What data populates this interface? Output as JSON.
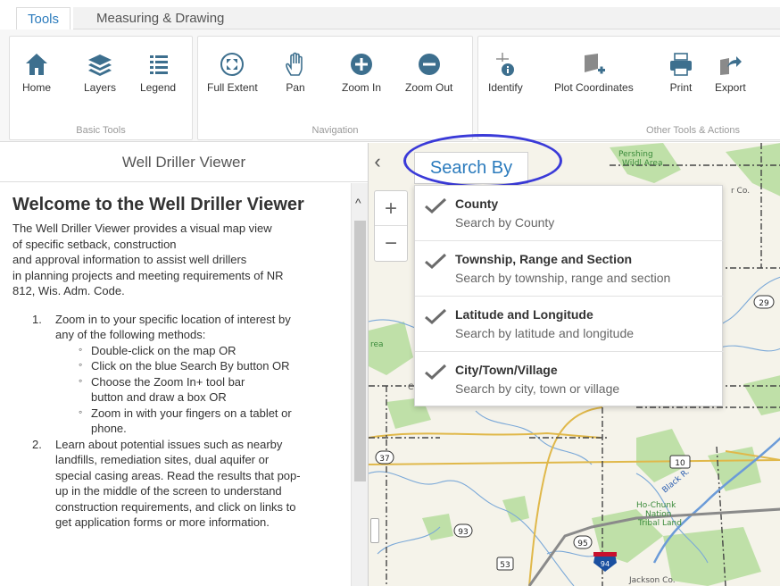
{
  "tabs": [
    {
      "label": "Tools",
      "active": true
    },
    {
      "label": "Measuring & Drawing",
      "active": false
    }
  ],
  "ribbon": {
    "groups": [
      {
        "caption": "Basic Tools",
        "tools": [
          {
            "label": "Home",
            "icon": "home-icon"
          },
          {
            "label": "Layers",
            "icon": "layers-icon"
          },
          {
            "label": "Legend",
            "icon": "legend-icon"
          }
        ]
      },
      {
        "caption": "Navigation",
        "tools": [
          {
            "label": "Full Extent",
            "icon": "full-extent-icon"
          },
          {
            "label": "Pan",
            "icon": "pan-hand-icon"
          },
          {
            "label": "Zoom In",
            "icon": "zoom-in-icon"
          },
          {
            "label": "Zoom Out",
            "icon": "zoom-out-icon"
          }
        ]
      },
      {
        "caption": "Other Tools & Actions",
        "tools": [
          {
            "label": "Identify",
            "icon": "identify-icon"
          },
          {
            "label": "Plot Coordinates",
            "icon": "plot-coordinates-icon"
          },
          {
            "label": "Print",
            "icon": "print-icon"
          },
          {
            "label": "Export",
            "icon": "export-icon"
          }
        ]
      }
    ]
  },
  "left_panel": {
    "title": "Well Driller Viewer",
    "welcome_title": "Welcome to the Well Driller Viewer",
    "intro_lines": [
      "The Well Driller Viewer provides a visual map view",
      "of specific setback, construction",
      "and approval information to assist well drillers",
      "in planning projects and meeting requirements of NR",
      "812, Wis. Adm. Code."
    ],
    "steps": [
      {
        "num": "1.",
        "lines": [
          "Zoom in to your specific location of interest by",
          "any of the following methods:"
        ],
        "sub": [
          [
            "Double-click on the map OR"
          ],
          [
            "Click on the blue Search By button OR"
          ],
          [
            "Choose the Zoom In+ tool bar",
            "button and draw a box OR"
          ],
          [
            "Zoom in with your fingers on a tablet or",
            "phone."
          ]
        ]
      },
      {
        "num": "2.",
        "lines": [
          "Learn about potential issues such as nearby",
          "landfills, remediation sites, dual aquifer or",
          "special casing areas.  Read the results that pop-",
          "up in the middle of the screen to understand",
          "construction requirements, and click on links to",
          "get application forms or more information."
        ],
        "sub": []
      }
    ]
  },
  "map": {
    "search_by_label": "Search By",
    "zoom_in_symbol": "+",
    "zoom_out_symbol": "−",
    "collapse_symbol": "‹",
    "search_options": [
      {
        "title": "County",
        "subtitle": "Search by County"
      },
      {
        "title": "Township, Range and Section",
        "subtitle": "Search by township, range and section"
      },
      {
        "title": "Latitude and Longitude",
        "subtitle": "Search by latitude and longitude"
      },
      {
        "title": "City/Town/Village",
        "subtitle": "Search by city, town or village"
      }
    ],
    "labels": {
      "pershing": "Pershing",
      "wildarea": "Wildl Area",
      "co": "r Co.",
      "ho_chunk": "Ho-Chunk",
      "nation": "Nation",
      "tribal": "Tribal Land",
      "jackson": "Jackson Co.",
      "black_r": "Black R.",
      "rea": "rea",
      "c": "C"
    },
    "route_shields": [
      "29",
      "37",
      "10",
      "93",
      "95",
      "94",
      "53"
    ],
    "colors": {
      "accent": "#2b7bbd",
      "highlight_circle": "#3a3ad8",
      "interstate": "#1a4fa0",
      "interstate_top": "#c8102e"
    }
  }
}
